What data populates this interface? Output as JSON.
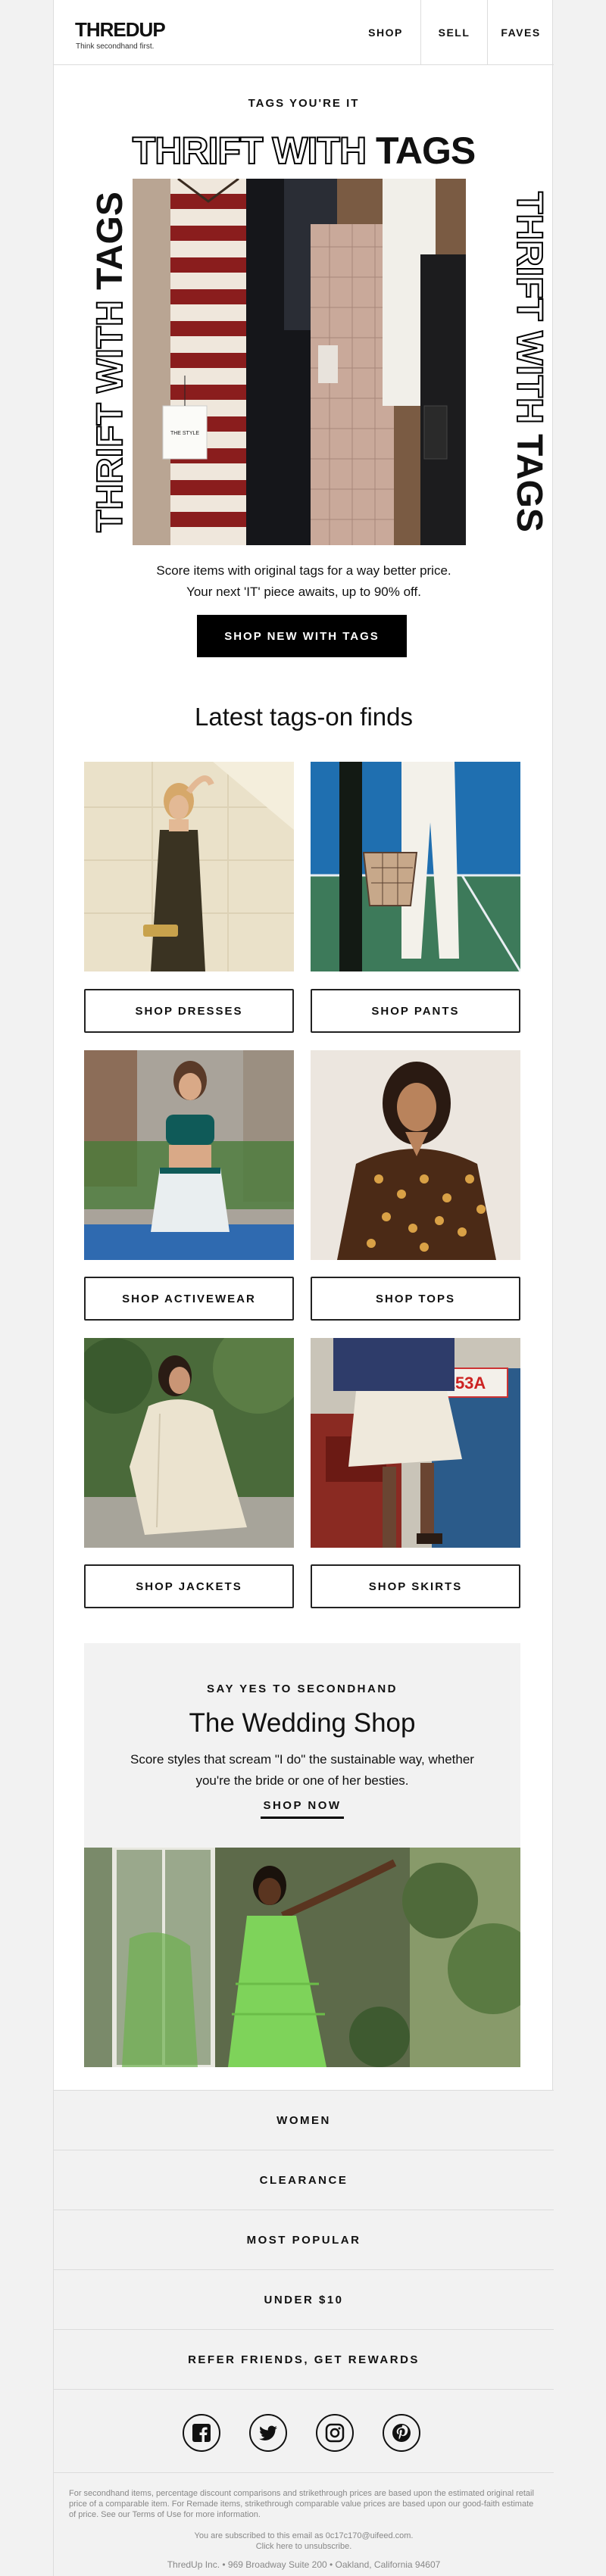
{
  "header": {
    "logo": "THREDUP",
    "tagline": "Think secondhand first.",
    "nav": [
      "SHOP",
      "SELL",
      "FAVES"
    ]
  },
  "hero": {
    "eyebrow": "TAGS YOU'RE IT",
    "title_outline": "THRIFT WITH",
    "title_solid": "TAGS",
    "copy_line1": "Score items with original tags for a way better price.",
    "copy_line2": "Your next 'IT' piece awaits, up to 90% off.",
    "cta": "SHOP NEW WITH TAGS",
    "hang_tag": "THE STYLE"
  },
  "finds": {
    "title": "Latest tags-on finds",
    "buttons": [
      "SHOP DRESSES",
      "SHOP PANTS",
      "SHOP ACTIVEWEAR",
      "SHOP TOPS",
      "SHOP JACKETS",
      "SHOP SKIRTS"
    ],
    "shop_sign": "153A"
  },
  "wedding": {
    "eyebrow": "SAY YES TO SECONDHAND",
    "title": "The Wedding Shop",
    "copy": "Score styles that scream \"I do\" the sustainable way, whether you're the bride or one of her besties.",
    "link": "SHOP NOW"
  },
  "footer": {
    "links": [
      "WOMEN",
      "CLEARANCE",
      "MOST POPULAR",
      "UNDER $10",
      "REFER FRIENDS, GET REWARDS"
    ],
    "social": [
      "facebook-icon",
      "twitter-icon",
      "instagram-icon",
      "pinterest-icon"
    ],
    "disclaimer": "For secondhand items, percentage discount comparisons and strikethrough prices are based upon the estimated original retail price of a comparable item. For Remade items, strikethrough comparable value prices are based upon our good-faith estimate of price. See our Terms of Use for more information.",
    "subscribed": "You are subscribed to this email as 0c17c170@uifeed.com.",
    "unsubscribe": "Click here to unsubscribe.",
    "address": "ThredUp Inc. • 969 Broadway Suite 200 • Oakland, California 94607"
  },
  "colors": {
    "background": "#f2f2f2",
    "accent": "#000000",
    "panel": "#f2f2f2"
  }
}
